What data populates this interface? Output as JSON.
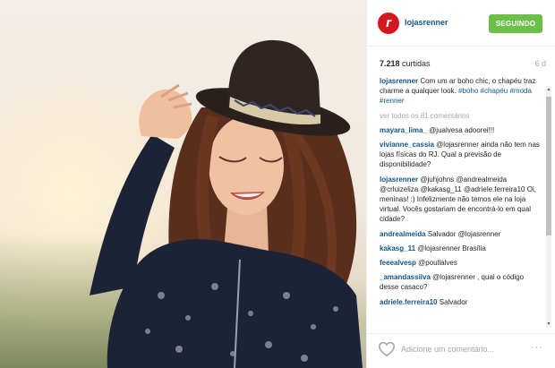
{
  "post": {
    "username": "lojasrenner",
    "follow_label": "SEGUINDO",
    "likes_count": "7.218",
    "likes_label": "curtidas",
    "time": "6 d",
    "caption": {
      "user": "lojasrenner",
      "text": "Com um ar boho chic, o chapéu traz charme a qualquer look.",
      "hashtags": "#boho #chapéu #moda #renner"
    },
    "view_all": "ver todos os 81 comentários",
    "comments": [
      {
        "user": "mayara_lima_",
        "text": "@jualvesa adoorei!!!"
      },
      {
        "user": "vivianne_cassia",
        "text": "@lojasrenner ainda não tem nas lojas físicas do RJ. Qual a previsão de disponibilidade?"
      },
      {
        "user": "lojasrenner",
        "text": "@juhjohns @andrealmeida @crluizeliza @kakasg_11 @adriele.ferreira10 Oi, meninas! :) Infelizmente não temos ele na loja virtual. Vocês gostariam de encontrá-lo em qual cidade?"
      },
      {
        "user": "andrealmeida",
        "text": "Salvador @lojasrenner"
      },
      {
        "user": "kakasg_11",
        "text": "@lojasrenner Brasília"
      },
      {
        "user": "feeealvesp",
        "text": "@poullalves"
      },
      {
        "user": "_amandassilva",
        "text": "@lojasrenner , qual o código desse casaco?"
      },
      {
        "user": "adriele.ferreira10",
        "text": "Salvador"
      }
    ],
    "comment_placeholder": "Adicione um comentário...",
    "more_label": "···"
  },
  "icons": {
    "heart": "heart-icon",
    "avatar": "renner-logo-icon",
    "more": "more-options-icon"
  },
  "colors": {
    "follow_green": "#6cc04a",
    "link_blue": "#125688",
    "brand_red": "#d4181f",
    "muted": "#a5a7aa"
  }
}
